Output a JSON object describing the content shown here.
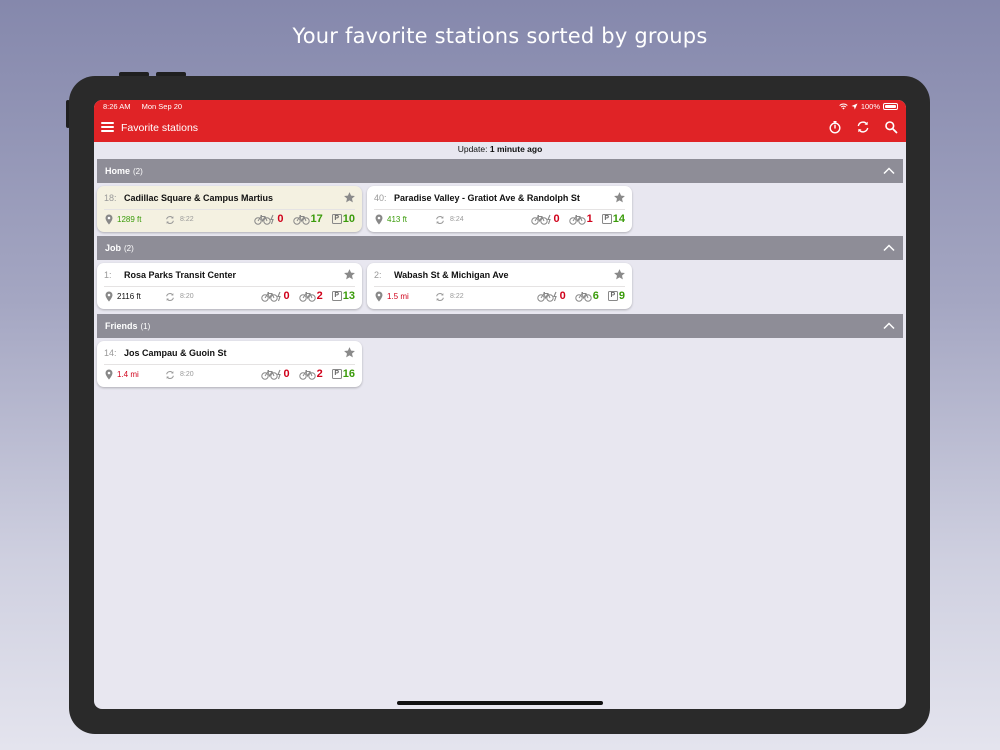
{
  "caption": "Your favorite stations sorted by groups",
  "status_bar": {
    "time": "8:26 AM",
    "date": "Mon Sep 20",
    "battery": "100%"
  },
  "app_bar": {
    "title": "Favorite stations",
    "actions": [
      "timer-icon",
      "refresh-icon",
      "search-icon"
    ]
  },
  "update": {
    "label": "Update:",
    "value": "1 minute ago"
  },
  "colors": {
    "brand": "#e02326",
    "group_header": "#8e8d97",
    "green": "#3a9b0a",
    "red": "#d0021b",
    "highlight": "#f4f1e1"
  },
  "groups": [
    {
      "name": "Home",
      "count": "(2)",
      "stations": [
        {
          "num": "18:",
          "name": "Cadillac Square & Campus Martius",
          "distance": "1289 ft",
          "time": "8:22",
          "ebikes": "0",
          "bikes": "17",
          "stands": "10",
          "highlighted": true,
          "distance_color": "green",
          "ebikes_color": "red",
          "bikes_color": "green",
          "stands_color": "green"
        },
        {
          "num": "40:",
          "name": "Paradise Valley - Gratiot Ave & Randolph St",
          "distance": "413 ft",
          "time": "8:24",
          "ebikes": "0",
          "bikes": "1",
          "stands": "14",
          "highlighted": false,
          "distance_color": "green",
          "ebikes_color": "red",
          "bikes_color": "red",
          "stands_color": "green"
        }
      ]
    },
    {
      "name": "Job",
      "count": "(2)",
      "stations": [
        {
          "num": "1:",
          "name": "Rosa Parks Transit Center",
          "distance": "2116 ft",
          "time": "8:20",
          "ebikes": "0",
          "bikes": "2",
          "stands": "13",
          "highlighted": false,
          "distance_color": "black",
          "ebikes_color": "red",
          "bikes_color": "red",
          "stands_color": "green"
        },
        {
          "num": "2:",
          "name": "Wabash St & Michigan Ave",
          "distance": "1.5 mi",
          "time": "8:22",
          "ebikes": "0",
          "bikes": "6",
          "stands": "9",
          "highlighted": false,
          "distance_color": "red",
          "ebikes_color": "red",
          "bikes_color": "green",
          "stands_color": "green"
        }
      ]
    },
    {
      "name": "Friends",
      "count": "(1)",
      "stations": [
        {
          "num": "14:",
          "name": "Jos Campau & Guoin St",
          "distance": "1.4 mi",
          "time": "8:20",
          "ebikes": "0",
          "bikes": "2",
          "stands": "16",
          "highlighted": false,
          "distance_color": "red",
          "ebikes_color": "red",
          "bikes_color": "red",
          "stands_color": "green"
        }
      ]
    }
  ]
}
